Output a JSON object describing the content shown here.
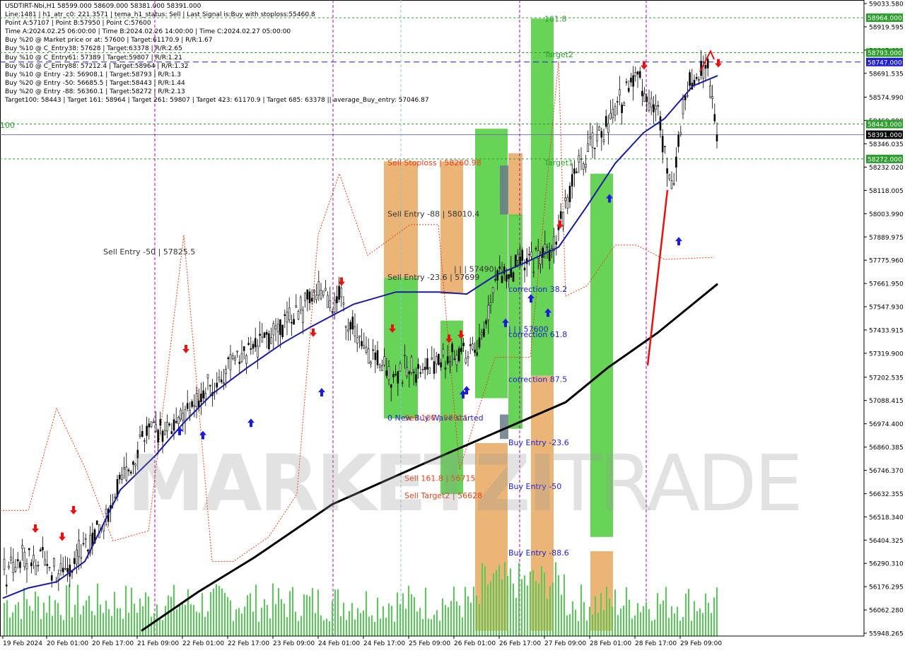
{
  "info_lines": [
    "USDTIRT-Nbi,H1  58599.000 58609.000 58381.000 58391.000",
    "Line:1481  |  h1_atr_c0: 221.3571  |  tema_h1_status: Sell  |  Last Signal is:Buy with stoploss:55460.8",
    "Point A:57107 | Point B:57950 | Point C:57600",
    "Time A:2024.02.25 06:00:00 | Time B:2024.02.26 14:00:00 | Time C:2024.02.27 05:00:00",
    "Buy %20 @ Market price or at: 57600 | Target:61170.9 | R/R:1.67",
    "Buy %10 @ C_Entry38: 57628 | Target:63378 | R/R:2.65",
    "Buy %10 @ C_Entry61: 57389 | Target:59807 | R/R:1.21",
    "Buy %10 @ C_Entry88: 57212.4 | Target:58964 | R/R:1.32",
    "Buy %10 @ Entry -23: 56908.1 | Target:58793 | R/R:1.3",
    "Buy %20 @ Entry -50: 56685.5 | Target:58443 | R/R:1.44",
    "Buy %20 @ Entry -88: 56360.1 | Target:58272 | R/R:2.13",
    "Target100: 58443 | Target 161: 58964 | Target 261: 59807 | Target 423: 61170.9 | Target 685: 63378 || average_Buy_entry: 57046.87"
  ],
  "watermark": {
    "bold": "MARKETZI",
    "lite": "TRADE"
  },
  "chart_data": {
    "type": "candlestick",
    "symbol": "USDTIRT-Nbi",
    "timeframe": "H1",
    "ohlc_last": {
      "open": 58599.0,
      "high": 58609.0,
      "low": 58381.0,
      "close": 58391.0
    },
    "ylim": [
      59033.58,
      55948.265
    ],
    "y_ticks": [
      "59033.580",
      "58919.595",
      "58805.610",
      "58691.535",
      "58574.990",
      "58460.990",
      "58346.035",
      "58232.020",
      "58118.005",
      "58003.990",
      "57889.975",
      "57775.960",
      "57661.950",
      "57547.930",
      "57433.915",
      "57319.900",
      "57202.535",
      "57088.415",
      "56974.400",
      "56860.385",
      "56746.370",
      "56632.355",
      "56518.340",
      "56404.325",
      "56290.310",
      "56176.295",
      "56062.280",
      "55948.265"
    ],
    "x_labels": [
      "19 Feb 2024",
      "20 Feb 01:00",
      "20 Feb 17:00",
      "21 Feb 09:00",
      "22 Feb 01:00",
      "22 Feb 17:00",
      "23 Feb 09:00",
      "24 Feb 01:00",
      "24 Feb 17:00",
      "25 Feb 09:00",
      "26 Feb 01:00",
      "26 Feb 17:00",
      "27 Feb 09:00",
      "28 Feb 01:00",
      "28 Feb 17:00",
      "29 Feb 09:00"
    ],
    "price_tags": [
      {
        "label": "58964.000",
        "color": "#2e9e2e"
      },
      {
        "label": "58793.000",
        "color": "#2e9e2e"
      },
      {
        "label": "58747.000",
        "color": "#1f1fd0"
      },
      {
        "label": "58443.000",
        "color": "#2e9e2e"
      },
      {
        "label": "58391.000",
        "color": "#000000"
      },
      {
        "label": "58272.000",
        "color": "#2e9e2e"
      }
    ],
    "price_tag_values": [
      58964,
      58793,
      58747,
      58443,
      58391,
      58272
    ],
    "annotations": [
      {
        "text": "161.8",
        "color": "#2e9e2e",
        "time": "27 Feb 09:00",
        "price": 58945
      },
      {
        "text": "Target2",
        "color": "#2e9e2e",
        "time": "27 Feb 09:00",
        "price": 58770
      },
      {
        "text": "100",
        "color": "#2e9e2e",
        "time": "27 Feb 17:00",
        "price": 58425
      },
      {
        "text": "Target1",
        "color": "#2e9e2e",
        "time": "27 Feb 09:00",
        "price": 58240
      },
      {
        "text": "Sell Stoploss | 58260.98",
        "color": "#e8401a",
        "time": "24 Feb 17:00",
        "price": 58240
      },
      {
        "text": "Sell Entry -88 | 58010.4",
        "color": "#333333",
        "time": "24 Feb 17:00",
        "price": 57990
      },
      {
        "text": "Sell Entry -50 | 57825.5",
        "color": "#333333",
        "time": "24 Feb 09:00",
        "price": 57805
      },
      {
        "text": "Sell Entry -23.6 | 57699",
        "color": "#333333",
        "time": "24 Feb 17:00",
        "price": 57680
      },
      {
        "text": "| | | 57490",
        "color": "#333333",
        "time": "26 Feb 01:00",
        "price": 57720
      },
      {
        "text": "correction 38.2",
        "color": "#1f1fd0",
        "time": "26 Feb 17:00",
        "price": 57620
      },
      {
        "text": "| | | 57600",
        "color": "#1f1fd0",
        "time": "26 Feb 17:00",
        "price": 57425
      },
      {
        "text": "correction 61.8",
        "color": "#1f1fd0",
        "time": "26 Feb 17:00",
        "price": 57400
      },
      {
        "text": "correction 87.5",
        "color": "#1f1fd0",
        "time": "26 Feb 17:00",
        "price": 57180
      },
      {
        "text": "0 New Buy Wave started",
        "color": "#1f1fd0",
        "time": "24 Feb 17:00",
        "price": 56990
      },
      {
        "text": "Sell 100 | 57011",
        "color": "#e8401a",
        "time": "25 Feb 09:00",
        "price": 56990
      },
      {
        "text": "Buy Entry -23.6",
        "color": "#1f1fd0",
        "time": "26 Feb 17:00",
        "price": 56870
      },
      {
        "text": "Sell 161.8 | 56715",
        "color": "#e8401a",
        "time": "25 Feb 09:00",
        "price": 56695
      },
      {
        "text": "Buy Entry -50",
        "color": "#1f1fd0",
        "time": "26 Feb 17:00",
        "price": 56655
      },
      {
        "text": "Sell Target2 | 56628",
        "color": "#e8401a",
        "time": "25 Feb 09:00",
        "price": 56610
      },
      {
        "text": "Buy Entry -88.6",
        "color": "#1f1fd0",
        "time": "26 Feb 17:00",
        "price": 56330
      }
    ]
  }
}
